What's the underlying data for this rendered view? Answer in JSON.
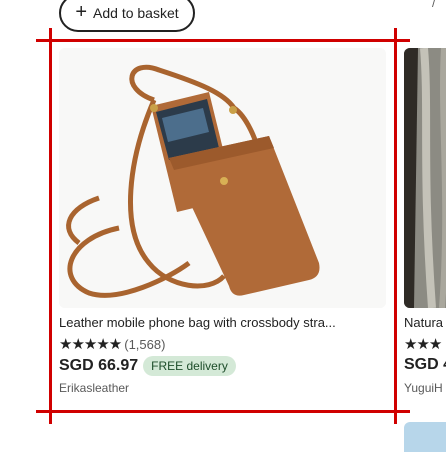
{
  "add_to_basket": {
    "label": "Add to basket"
  },
  "top_right_glyph": "/",
  "product": {
    "title": "Leather mobile phone bag with crossbody stra...",
    "stars": "★★★★★",
    "review_count": "(1,568)",
    "rating": 5,
    "price": "SGD 66.97",
    "badge": "FREE delivery",
    "shop": "Erikasleather",
    "image_icon": "phone-bag-image"
  },
  "next_product": {
    "title": "Natura",
    "stars": "★★★",
    "price": "SGD 4",
    "shop": "YuguiH"
  },
  "colors": {
    "annotation_red": "#d00000",
    "badge_bg": "#d4e9d7",
    "badge_text": "#1d4d2a",
    "leather": "#b06a38"
  }
}
